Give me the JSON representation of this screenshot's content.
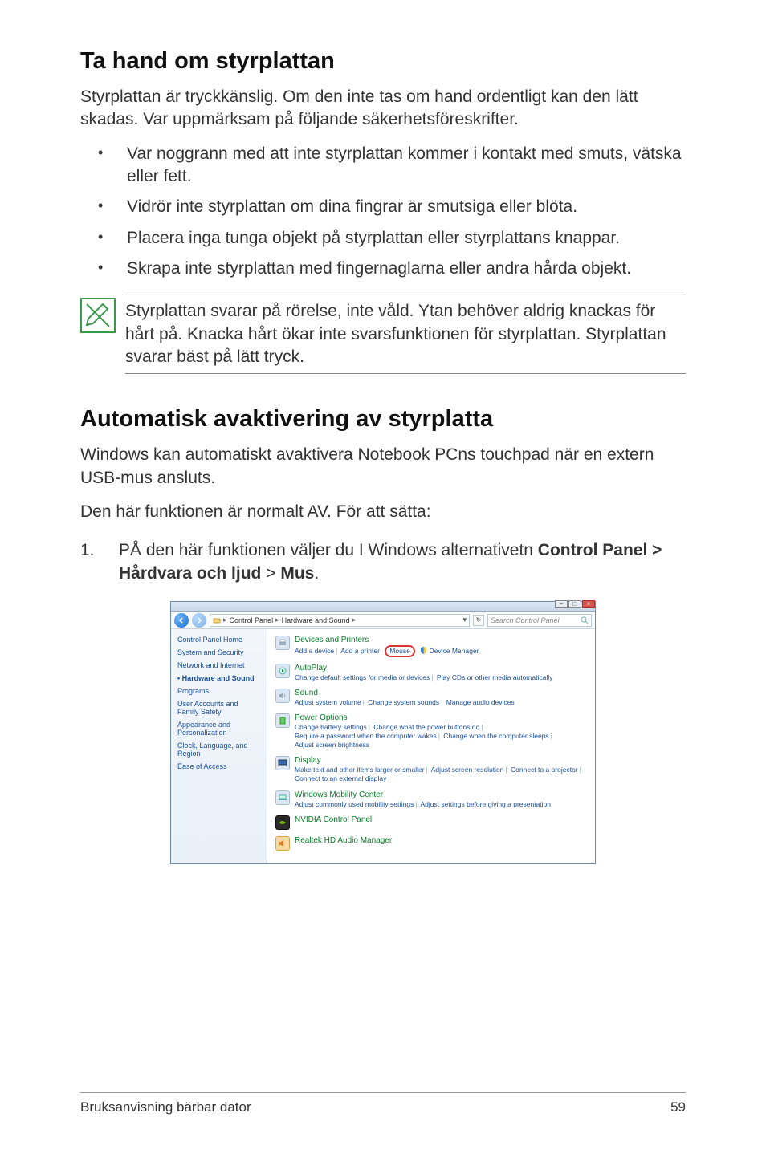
{
  "heading1": "Ta hand om styrplattan",
  "para1": "Styrplattan är tryckkänslig. Om den inte tas om hand ordentligt kan den lätt skadas. Var uppmärksam på följande säkerhetsföreskrifter.",
  "bullets": [
    "Var noggrann med att inte styrplattan kommer i kontakt med smuts, vätska eller fett.",
    "Vidrör inte styrplattan om dina fingrar är smutsiga eller blöta.",
    "Placera inga tunga objekt på styrplattan eller styrplattans knappar.",
    "Skrapa inte styrplattan med fingernaglarna eller andra hårda objekt."
  ],
  "note": "Styrplattan svarar på rörelse, inte våld. Ytan behöver aldrig knackas för hårt på. Knacka hårt ökar inte svarsfunktionen för styrplattan. Styrplattan svarar bäst på lätt tryck.",
  "heading2": "Automatisk avaktivering av styrplatta",
  "para2": "Windows kan automatiskt avaktivera Notebook PCns touchpad när en extern USB-mus ansluts.",
  "para3": "Den här funktionen är normalt AV. För att sätta:",
  "step1_num": "1.",
  "step1_a": "PÅ den här funktionen väljer du I Windows alternativetn ",
  "step1_b": "Control Panel > Hårdvara och ljud",
  "step1_c": " > ",
  "step1_d": "Mus",
  "step1_e": ".",
  "cp": {
    "winbtn_min": "–",
    "winbtn_max": "□",
    "winbtn_close": "×",
    "crumb1": "Control Panel",
    "crumb2": "Hardware and Sound",
    "refresh": "↻",
    "search_placeholder": "Search Control Panel",
    "side": {
      "home": "Control Panel Home",
      "system": "System and Security",
      "network": "Network and Internet",
      "hardware": "Hardware and Sound",
      "programs": "Programs",
      "users": "User Accounts and Family Safety",
      "appearance": "Appearance and Personalization",
      "clock": "Clock, Language, and Region",
      "ease": "Ease of Access"
    },
    "cats": {
      "devices": {
        "title": "Devices and Printers",
        "l1": "Add a device",
        "l2": "Add a printer",
        "l3": "Mouse",
        "l4": "Device Manager"
      },
      "autoplay": {
        "title": "AutoPlay",
        "l1": "Change default settings for media or devices",
        "l2": "Play CDs or other media automatically"
      },
      "sound": {
        "title": "Sound",
        "l1": "Adjust system volume",
        "l2": "Change system sounds",
        "l3": "Manage audio devices"
      },
      "power": {
        "title": "Power Options",
        "l1": "Change battery settings",
        "l2": "Change what the power buttons do",
        "l3": "Require a password when the computer wakes",
        "l4": "Change when the computer sleeps",
        "l5": "Adjust screen brightness"
      },
      "display": {
        "title": "Display",
        "l1": "Make text and other items larger or smaller",
        "l2": "Adjust screen resolution",
        "l3": "Connect to a projector",
        "l4": "Connect to an external display"
      },
      "mobility": {
        "title": "Windows Mobility Center",
        "l1": "Adjust commonly used mobility settings",
        "l2": "Adjust settings before giving a presentation"
      },
      "nvidia": {
        "title": "NVIDIA Control Panel"
      },
      "realtek": {
        "title": "Realtek HD Audio Manager"
      }
    }
  },
  "footer_left": "Bruksanvisning bärbar dator",
  "footer_right": "59"
}
